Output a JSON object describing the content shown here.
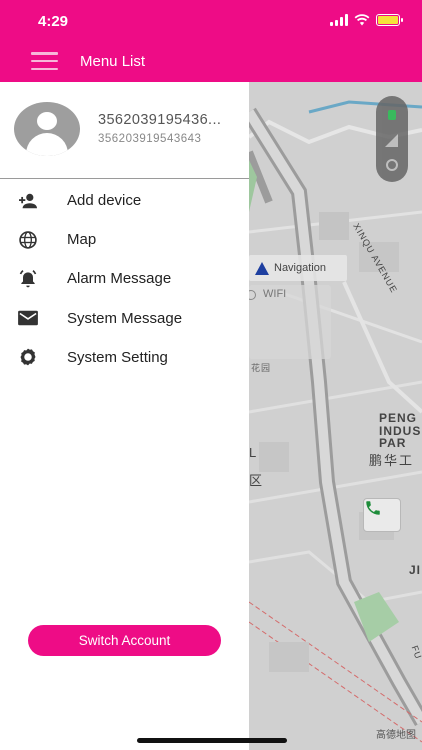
{
  "status_bar": {
    "time": "4:29"
  },
  "header": {
    "title": "Menu List"
  },
  "profile": {
    "name": "3562039195436...",
    "id": "356203919543643"
  },
  "menu": [
    {
      "label": "Add device",
      "icon": "add-person-icon"
    },
    {
      "label": "Map",
      "icon": "globe-icon"
    },
    {
      "label": "Alarm Message",
      "icon": "alarm-icon"
    },
    {
      "label": "System Message",
      "icon": "mail-icon"
    },
    {
      "label": "System Setting",
      "icon": "gear-icon"
    }
  ],
  "footer": {
    "switch_account": "Switch Account"
  },
  "map": {
    "navigation_label": "Navigation",
    "wifi_label": "WIFI",
    "street_label": "XINQU AVENUE",
    "district_label": "PENG\nINDUS\nPAR",
    "district_cn": "鹏华工",
    "brand": "高德地图",
    "partial_labels": [
      "L",
      "区",
      "JI",
      "FU",
      "花园"
    ]
  },
  "colors": {
    "brand_pink": "#ee0c86",
    "map_bg": "#cfcfcf"
  }
}
